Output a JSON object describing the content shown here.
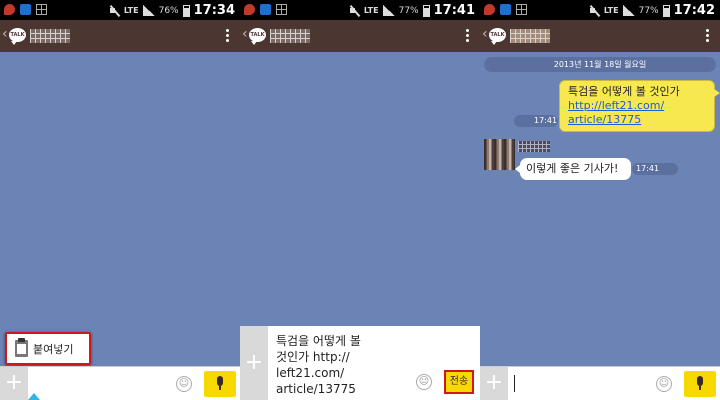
{
  "colors": {
    "chat_bg": "#6b84b5",
    "header_bg": "#4b3632",
    "accent_yellow": "#f7d900",
    "highlight_red": "#d01818"
  },
  "screens": [
    {
      "status": {
        "battery": "76%",
        "time": "17:34",
        "network": "LTE"
      },
      "header": {
        "icons": [
          "back-chevron",
          "talk-logo",
          "overflow-menu"
        ]
      },
      "paste_popup": {
        "label": "붙여넣기",
        "icon": "clipboard-icon"
      },
      "input": {
        "value": ""
      }
    },
    {
      "status": {
        "battery": "77%",
        "time": "17:41",
        "network": "LTE"
      },
      "compose": {
        "text": "특검을 어떻게 볼\n것인가 http://\nleft21.com/\narticle/13775",
        "send_label": "전송"
      }
    },
    {
      "status": {
        "battery": "77%",
        "time": "17:42",
        "network": "LTE"
      },
      "date_divider": "2013년 11월 18일 월요일",
      "messages": [
        {
          "mine": true,
          "line1": "특검을 어떻게 볼 것인가",
          "link1": "http://left21.com/",
          "link2": "article/13775",
          "time": "17:41"
        },
        {
          "mine": false,
          "text": "이렇게 좋은 기사가!",
          "time": "17:41"
        }
      ]
    }
  ]
}
